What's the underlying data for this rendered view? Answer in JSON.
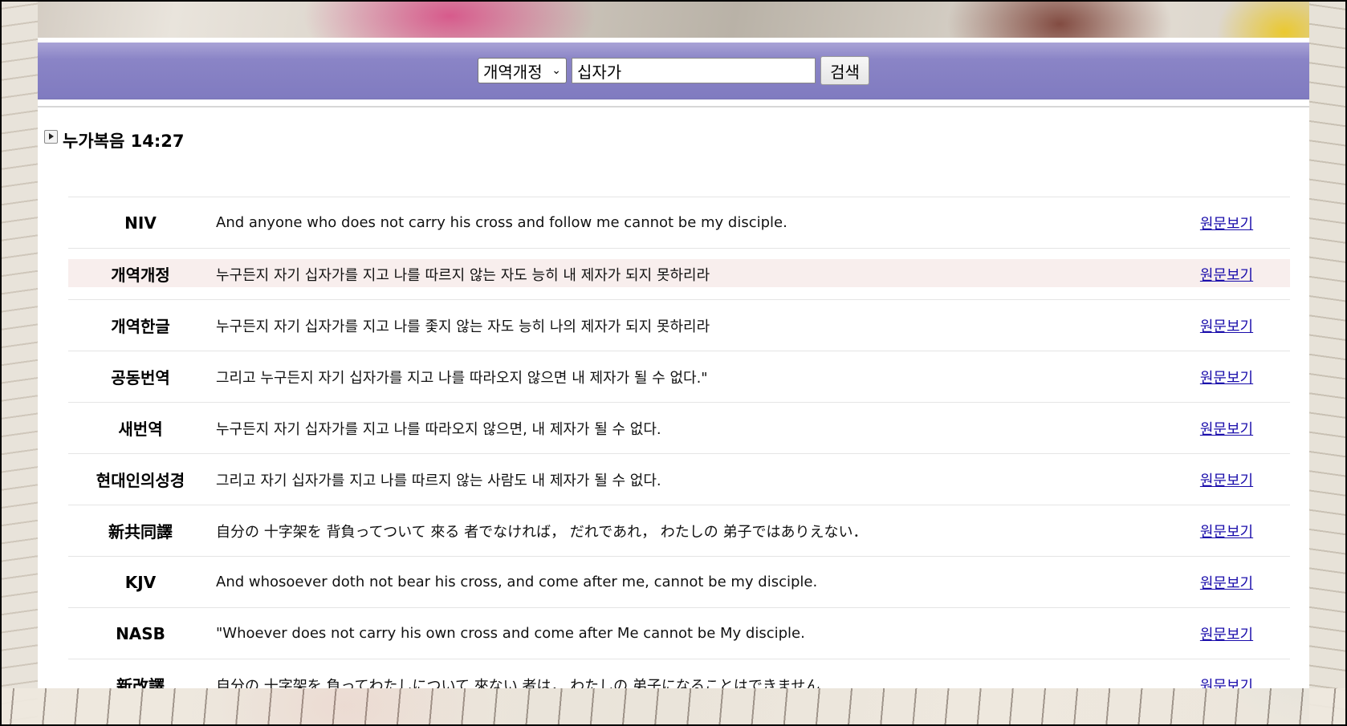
{
  "search": {
    "version_selected": "개역개정",
    "query": "십자가",
    "button_label": "검색"
  },
  "reference": {
    "title": "누가복음 14:27"
  },
  "verses": [
    {
      "version": "NIV",
      "text": "And anyone who does not carry his cross and follow me cannot be my disciple.",
      "link": "원문보기"
    },
    {
      "version": "개역개정",
      "text": "누구든지 자기 십자가를 지고 나를 따르지 않는 자도 능히 내 제자가 되지 못하리라",
      "link": "원문보기"
    },
    {
      "version": "개역한글",
      "text": "누구든지 자기 십자가를 지고 나를 좇지 않는 자도 능히 나의 제자가 되지 못하리라",
      "link": "원문보기"
    },
    {
      "version": "공동번역",
      "text": "그리고 누구든지 자기 십자가를 지고 나를 따라오지 않으면 내 제자가 될 수 없다.\"",
      "link": "원문보기"
    },
    {
      "version": "새번역",
      "text": "누구든지 자기 십자가를 지고 나를 따라오지 않으면, 내 제자가 될 수 없다.",
      "link": "원문보기"
    },
    {
      "version": "현대인의성경",
      "text": "그리고 자기 십자가를 지고 나를 따르지 않는 사람도 내 제자가 될 수 없다.",
      "link": "원문보기"
    },
    {
      "version": "新共同譯",
      "text": "自分の 十字架を 背負ってついて 來る 者でなければ， だれであれ， わたしの 弟子ではありえない．",
      "link": "원문보기"
    },
    {
      "version": "KJV",
      "text": "And whosoever doth not bear his cross, and come after me, cannot be my disciple.",
      "link": "원문보기"
    },
    {
      "version": "NASB",
      "text": "\"Whoever does not carry his own cross and come after Me cannot be My disciple.",
      "link": "원문보기"
    },
    {
      "version": "新改譯",
      "text": "自分の 十字架を 負ってわたしについて 來ない 者は， わたしの 弟子になることはできません．",
      "link": "원문보기"
    }
  ]
}
